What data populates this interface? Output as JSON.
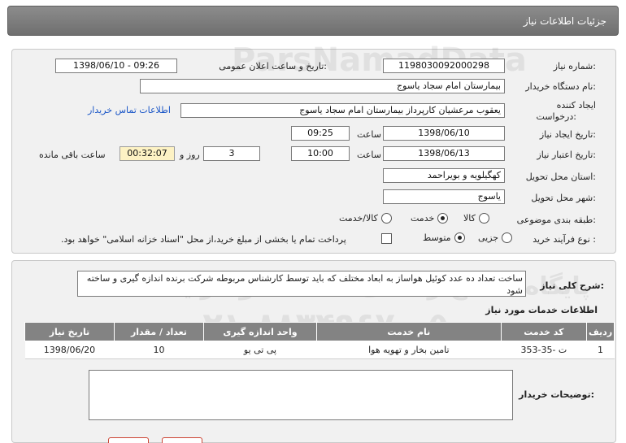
{
  "header": {
    "title": "جزئیات اطلاعات نیاز"
  },
  "form": {
    "need_number_label": "شماره نیاز:",
    "need_number": "1198030092000298",
    "announce_label": "تاریخ و ساعت اعلان عمومی:",
    "announce_value": "1398/06/10 - 09:26",
    "buyer_org_label": "نام دستگاه خریدار:",
    "buyer_org": "بیمارستان امام سجاد یاسوج",
    "creator_label_line1": "ایجاد کننده",
    "creator_label_line2": "درخواست:",
    "creator": "یعقوب مرعشیان کارپرداز بیمارستان امام سجاد یاسوج",
    "contact_link": "اطلاعات تماس خریدار",
    "created_date_label": "تاریخ ایجاد نیاز:",
    "created_date": "1398/06/10",
    "time_label": "ساعت",
    "created_time": "09:25",
    "validity_label": "تاریخ اعتبار نیاز:",
    "validity_date": "1398/06/13",
    "validity_time": "10:00",
    "days_value": "3",
    "days_label": "روز و",
    "remaining_time": "00:32:07",
    "remaining_label": "ساعت باقی مانده",
    "province_label": "استان محل تحویل:",
    "province": "کهگیلویه و بویراحمد",
    "city_label": "شهر محل تحویل:",
    "city": "یاسوج",
    "category_label": "طبقه بندی موضوعی:",
    "category_options": [
      {
        "label": "کالا",
        "selected": false
      },
      {
        "label": "خدمت",
        "selected": true
      },
      {
        "label": "کالا/خدمت",
        "selected": false
      }
    ],
    "process_label": "نوع فرآیند خرید :",
    "process_options": [
      {
        "label": "جزیی",
        "selected": false
      },
      {
        "label": "متوسط",
        "selected": true
      }
    ],
    "payment_note": "پرداخت تمام یا بخشی از مبلغ خرید،از محل \"اسناد خزانه اسلامی\" خواهد بود."
  },
  "details": {
    "summary_label": "شرح کلی نیاز:",
    "summary": "ساخت تعداد ده عدد کوئیل هواساز به ابعاد مختلف که باید توسط کارشناس مربوطه شرکت برنده اندازه گیری و ساخته شود",
    "services_title": "اطلاعات خدمات مورد نیاز",
    "table_headers": [
      "ردیف",
      "کد خدمت",
      "نام خدمت",
      "واحد اندازه گیری",
      "تعداد / مقدار",
      "تاریخ نیاز"
    ],
    "table_rows": [
      [
        "1",
        "ت -35-353",
        "تامین بخار و تهویه هوا",
        "پی تی یو",
        "10",
        "1398/06/20"
      ]
    ],
    "buyer_notes_label": "توضیحات خریدار:",
    "buyer_notes": ""
  },
  "watermark": {
    "line1": "پایگاه اطلاع رسانی مناقصه و مزایده",
    "line2": "ParsNamadData",
    "line3": "۰۲۱-۸۸۳۴۹۶۷۰-۵"
  }
}
